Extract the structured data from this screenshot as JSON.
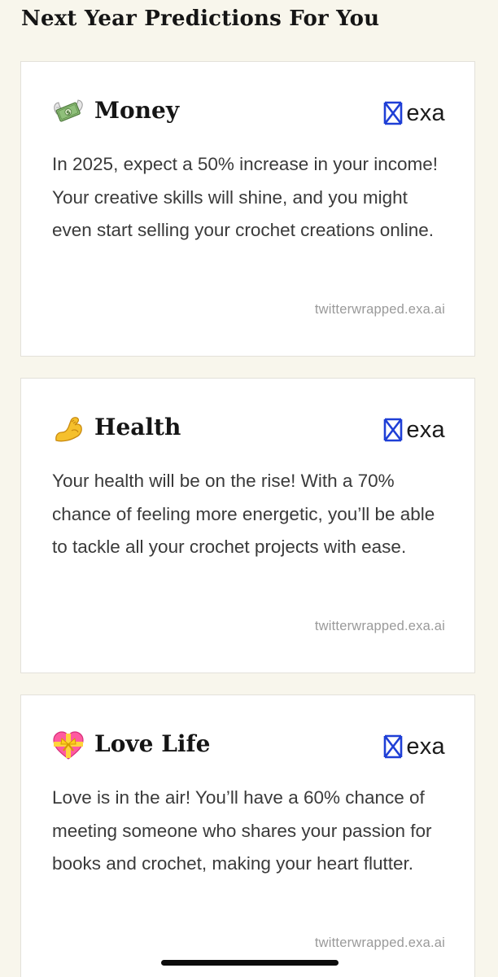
{
  "header": {
    "title": "Next Year Predictions For You"
  },
  "cards": [
    {
      "icon": "money-with-wings-icon",
      "title": "Money",
      "brand": "exa",
      "body": "In 2025, expect a 50% increase in your income! Your creative skills will shine, and you might even start selling your crochet creations online.",
      "link": "twitterwrapped.exa.ai"
    },
    {
      "icon": "flexed-biceps-icon",
      "title": "Health",
      "brand": "exa",
      "body": "Your health will be on the rise! With a 70% chance of feeling more energetic, you’ll be able to tackle all your crochet projects with ease.",
      "link": "twitterwrapped.exa.ai"
    },
    {
      "icon": "heart-with-ribbon-icon",
      "title": "Love Life",
      "brand": "exa",
      "body": "Love is in the air! You’ll have a 60% chance of meeting someone who shares your passion for books and crochet, making your heart flutter.",
      "link": "twitterwrapped.exa.ai"
    }
  ],
  "colors": {
    "page_background": "#f8f6ec",
    "card_background": "#ffffff",
    "brand_blue": "#1f3fd6",
    "link_gray": "#9a9a9a"
  }
}
